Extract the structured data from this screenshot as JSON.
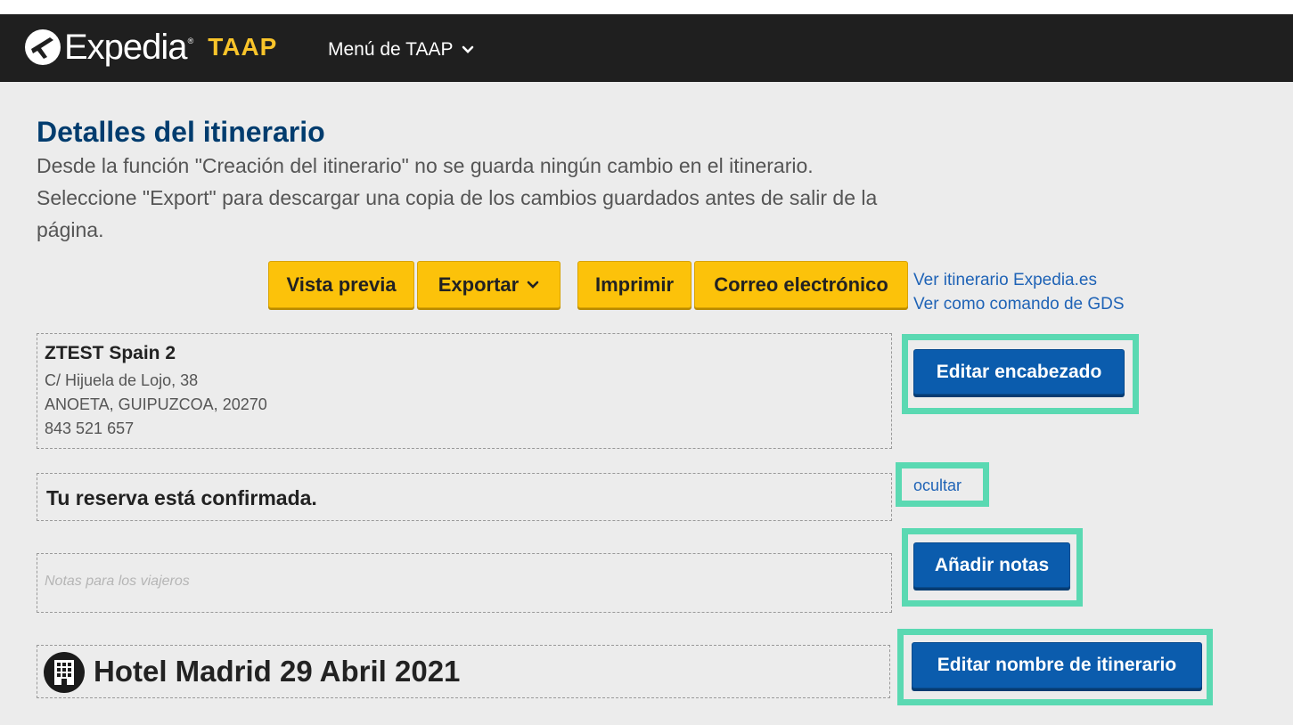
{
  "header": {
    "brand": "Expedia",
    "brand_tm": "®",
    "product": "TAAP",
    "menu_label": "Menú de TAAP",
    "colors": {
      "bar": "#1f1f1f",
      "taap": "#f9c42a"
    }
  },
  "page": {
    "title": "Detalles del itinerario",
    "description": "Desde la función \"Creación del itinerario\" no se guarda ningún cambio en el itinerario. Seleccione \"Export\" para descargar una copia de los cambios guardados antes de salir de la página."
  },
  "toolbar": {
    "preview_label": "Vista previa",
    "export_label": "Exportar",
    "print_label": "Imprimir",
    "email_label": "Correo electrónico",
    "view_site_link": "Ver itinerario Expedia.es",
    "view_gds_link": "Ver como comando de GDS",
    "accent_color": "#fcc20a"
  },
  "agency": {
    "name": "ZTEST Spain 2",
    "address_line1": "C/ Hijuela de Lojo, 38",
    "address_line2": "ANOETA, GUIPUZCOA, 20270",
    "phone": "843 521 657",
    "edit_header_label": "Editar encabezado"
  },
  "confirmation": {
    "text": "Tu reserva está confirmada.",
    "hide_link": "ocultar"
  },
  "notes": {
    "placeholder": "Notas para los viajeros",
    "add_notes_label": "Añadir notas"
  },
  "itinerary": {
    "icon": "hotel-building-icon",
    "name": "Hotel Madrid 29 Abril 2021",
    "edit_name_label": "Editar nombre de itinerario"
  },
  "highlight_color": "#5ad9b2"
}
